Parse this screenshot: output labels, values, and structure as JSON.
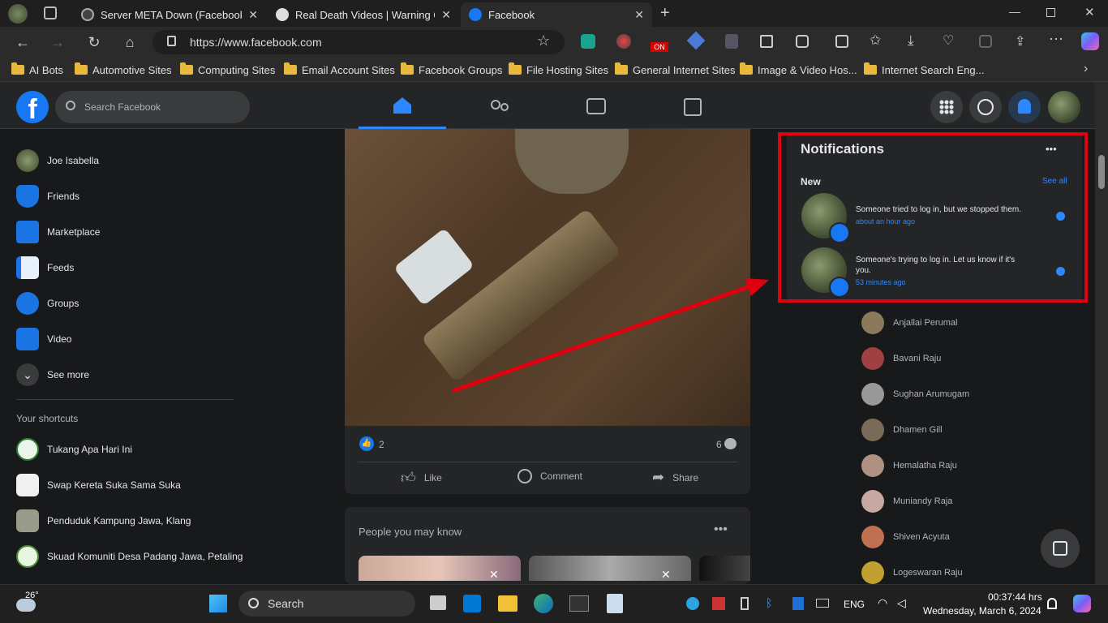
{
  "browser": {
    "tabs": [
      {
        "title": "Server META Down (Facebook, In"
      },
      {
        "title": "Real Death Videos | Warning Gra"
      },
      {
        "title": "Facebook"
      }
    ],
    "url": "https://www.facebook.com",
    "bookmarks": [
      "AI Bots",
      "Automotive Sites",
      "Computing Sites",
      "Email Account Sites",
      "Facebook Groups",
      "File Hosting Sites",
      "General Internet Sites",
      "Image & Video Hos...",
      "Internet Search Eng..."
    ],
    "extension_badge": "ON"
  },
  "facebook": {
    "search_placeholder": "Search Facebook",
    "sidebar": {
      "items": [
        {
          "label": "Joe Isabella"
        },
        {
          "label": "Friends"
        },
        {
          "label": "Marketplace"
        },
        {
          "label": "Feeds"
        },
        {
          "label": "Groups"
        },
        {
          "label": "Video"
        },
        {
          "label": "See more"
        }
      ],
      "shortcuts_title": "Your shortcuts",
      "shortcuts": [
        {
          "label": "Tukang Apa Hari Ini"
        },
        {
          "label": "Swap Kereta Suka Sama Suka"
        },
        {
          "label": "Penduduk Kampung Jawa, Klang"
        },
        {
          "label": "Skuad Komuniti Desa Padang Jawa, Petaling"
        }
      ]
    },
    "post": {
      "likes": "2",
      "comments": "6",
      "actions": {
        "like": "Like",
        "comment": "Comment",
        "share": "Share"
      }
    },
    "pymk": {
      "title": "People you may know"
    },
    "notifications": {
      "title": "Notifications",
      "section": "New",
      "see_all": "See all",
      "items": [
        {
          "text": "Someone tried to log in, but we stopped them.",
          "time": "about an hour ago"
        },
        {
          "text": "Someone's trying to log in. Let us know if it's you.",
          "time": "53 minutes ago"
        }
      ]
    },
    "contacts": [
      "Anjallai Perumal",
      "Bavani Raju",
      "Sughan Arumugam",
      "Dhamen Gill",
      "Hemalatha Raju",
      "Muniandy Raja",
      "Shiven Acyuta",
      "Logeswaran Raju"
    ]
  },
  "taskbar": {
    "temperature": "26°",
    "search_label": "Search",
    "lang": "ENG",
    "time": "00:37:44 hrs",
    "date": "Wednesday, March 6, 2024"
  },
  "colors": {
    "accent": "#1877f2",
    "highlight_box": "#e0000f"
  }
}
